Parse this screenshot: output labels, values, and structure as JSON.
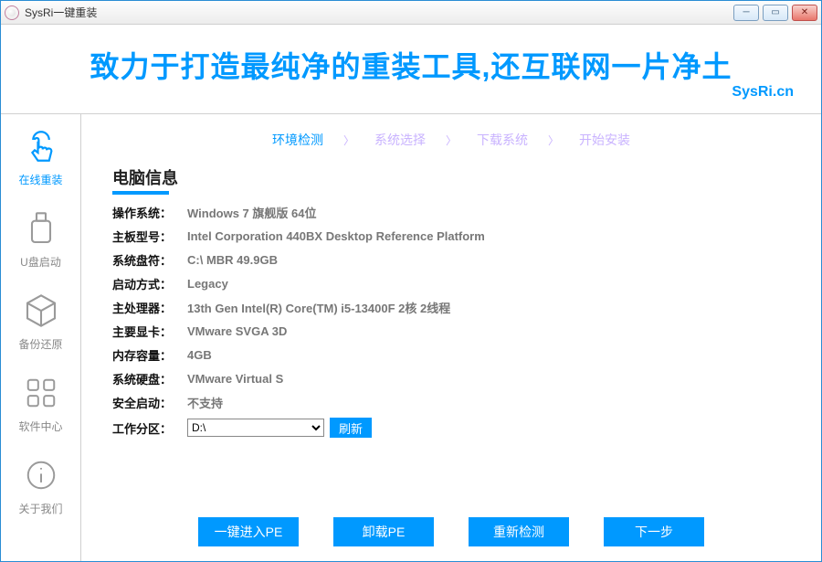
{
  "window": {
    "title": "SysRi一键重装"
  },
  "banner": {
    "slogan": "致力于打造最纯净的重装工具,还互联网一片净土",
    "brand": "SysRi.cn"
  },
  "sidebar": {
    "items": [
      {
        "label": "在线重装"
      },
      {
        "label": "U盘启动"
      },
      {
        "label": "备份还原"
      },
      {
        "label": "软件中心"
      },
      {
        "label": "关于我们"
      }
    ]
  },
  "steps": {
    "items": [
      {
        "label": "环境检测"
      },
      {
        "label": "系统选择"
      },
      {
        "label": "下载系统"
      },
      {
        "label": "开始安装"
      }
    ]
  },
  "section": {
    "title": "电脑信息"
  },
  "info": {
    "os_label": "操作系统：",
    "os_value": "Windows 7 旗舰版   64位",
    "board_label": "主板型号：",
    "board_value": "Intel Corporation 440BX Desktop Reference Platform",
    "sysdisk_label": "系统盘符：",
    "sysdisk_value": "C:\\ MBR 49.9GB",
    "boot_label": "启动方式：",
    "boot_value": "Legacy",
    "cpu_label": "主处理器：",
    "cpu_value": "13th Gen Intel(R) Core(TM) i5-13400F 2核 2线程",
    "gpu_label": "主要显卡：",
    "gpu_value": "VMware SVGA 3D",
    "mem_label": "内存容量：",
    "mem_value": "4GB",
    "disk_label": "系统硬盘：",
    "disk_value": "VMware Virtual S",
    "secure_label": "安全启动：",
    "secure_value": "不支持",
    "work_label": "工作分区：",
    "work_value": "D:\\",
    "refresh": "刷新"
  },
  "buttons": {
    "enter_pe": "一键进入PE",
    "unload_pe": "卸载PE",
    "recheck": "重新检测",
    "next": "下一步"
  }
}
